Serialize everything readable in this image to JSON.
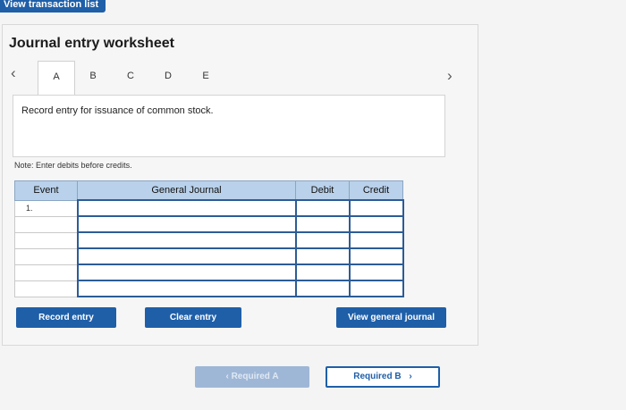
{
  "top_button": {
    "label": "View transaction list"
  },
  "title": "Journal entry worksheet",
  "tabs": [
    "A",
    "B",
    "C",
    "D",
    "E"
  ],
  "active_tab": "A",
  "instruction": "Record entry for issuance of common stock.",
  "note": "Note: Enter debits before credits.",
  "table": {
    "headers": {
      "event": "Event",
      "general_journal": "General Journal",
      "debit": "Debit",
      "credit": "Credit"
    },
    "rows": [
      {
        "event": "1.",
        "account": "",
        "debit": "",
        "credit": ""
      },
      {
        "event": "",
        "account": "",
        "debit": "",
        "credit": ""
      },
      {
        "event": "",
        "account": "",
        "debit": "",
        "credit": ""
      },
      {
        "event": "",
        "account": "",
        "debit": "",
        "credit": ""
      },
      {
        "event": "",
        "account": "",
        "debit": "",
        "credit": ""
      },
      {
        "event": "",
        "account": "",
        "debit": "",
        "credit": ""
      }
    ]
  },
  "buttons": {
    "record_entry": "Record entry",
    "clear_entry": "Clear entry",
    "view_general_journal": "View general journal"
  },
  "pager": {
    "prev_label": "Required A",
    "next_label": "Required B"
  }
}
